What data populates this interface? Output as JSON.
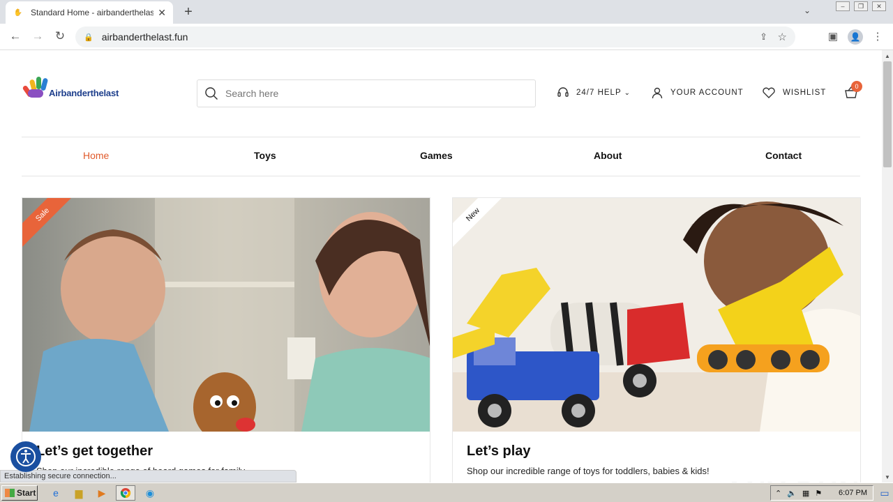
{
  "browser": {
    "tab_title": "Standard Home - airbanderthelast.fun",
    "url": "airbanderthelast.fun",
    "status_text": "Establishing secure connection..."
  },
  "site": {
    "logo_text": "Airbanderthelast",
    "search_placeholder": "Search here",
    "help_label": "24/7 HELP",
    "account_label": "YOUR ACCOUNT",
    "wishlist_label": "WISHLIST",
    "cart_count": "0",
    "accent_color": "#e05a2b",
    "nav": [
      {
        "label": "Home",
        "active": true
      },
      {
        "label": "Toys",
        "active": false
      },
      {
        "label": "Games",
        "active": false
      },
      {
        "label": "About",
        "active": false
      },
      {
        "label": "Contact",
        "active": false
      }
    ],
    "cards": [
      {
        "ribbon": "Sale",
        "title": "Let’s get together",
        "text": "Shop our incredible range of board games for family"
      },
      {
        "ribbon": "New",
        "title": "Let’s play",
        "text": "Shop our incredible range of toys for toddlers, babies & kids!"
      }
    ]
  },
  "watermark": "ANY RUN",
  "taskbar": {
    "start_label": "Start",
    "clock": "6:07 PM"
  }
}
